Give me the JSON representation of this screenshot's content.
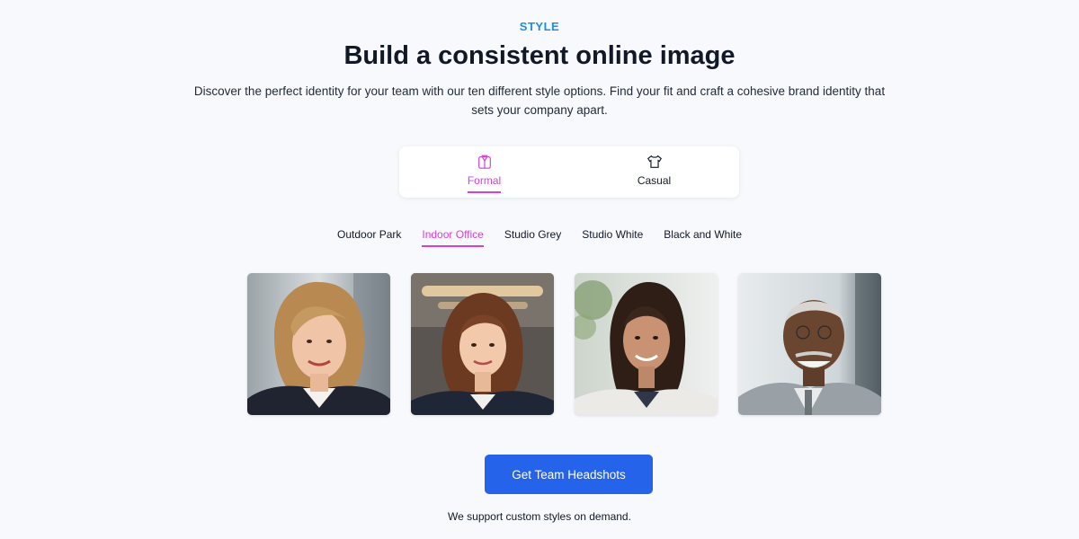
{
  "section": {
    "eyebrow": "STYLE",
    "title": "Build a consistent online image",
    "subtitle": "Discover the perfect identity for your team with our ten different style options. Find your fit and craft a cohesive brand identity that sets your company apart."
  },
  "style_tabs": [
    {
      "label": "Formal",
      "icon": "suit-icon",
      "active": true
    },
    {
      "label": "Casual",
      "icon": "tshirt-icon",
      "active": false
    }
  ],
  "sub_tabs": [
    {
      "label": "Outdoor Park",
      "active": false
    },
    {
      "label": "Indoor Office",
      "active": true
    },
    {
      "label": "Studio Grey",
      "active": false
    },
    {
      "label": "Studio White",
      "active": false
    },
    {
      "label": "Black and White",
      "active": false
    }
  ],
  "photos": [
    {
      "name": "headshot-woman-blonde"
    },
    {
      "name": "headshot-woman-auburn"
    },
    {
      "name": "headshot-woman-dark-hair"
    },
    {
      "name": "headshot-man-grey-hair"
    }
  ],
  "cta": {
    "label": "Get Team Headshots"
  },
  "note": "We support custom styles on demand.",
  "colors": {
    "accent": "#d63fd6",
    "primary_button": "#2563eb",
    "eyebrow": "#1d8fe0",
    "background": "#f7f9fc"
  }
}
